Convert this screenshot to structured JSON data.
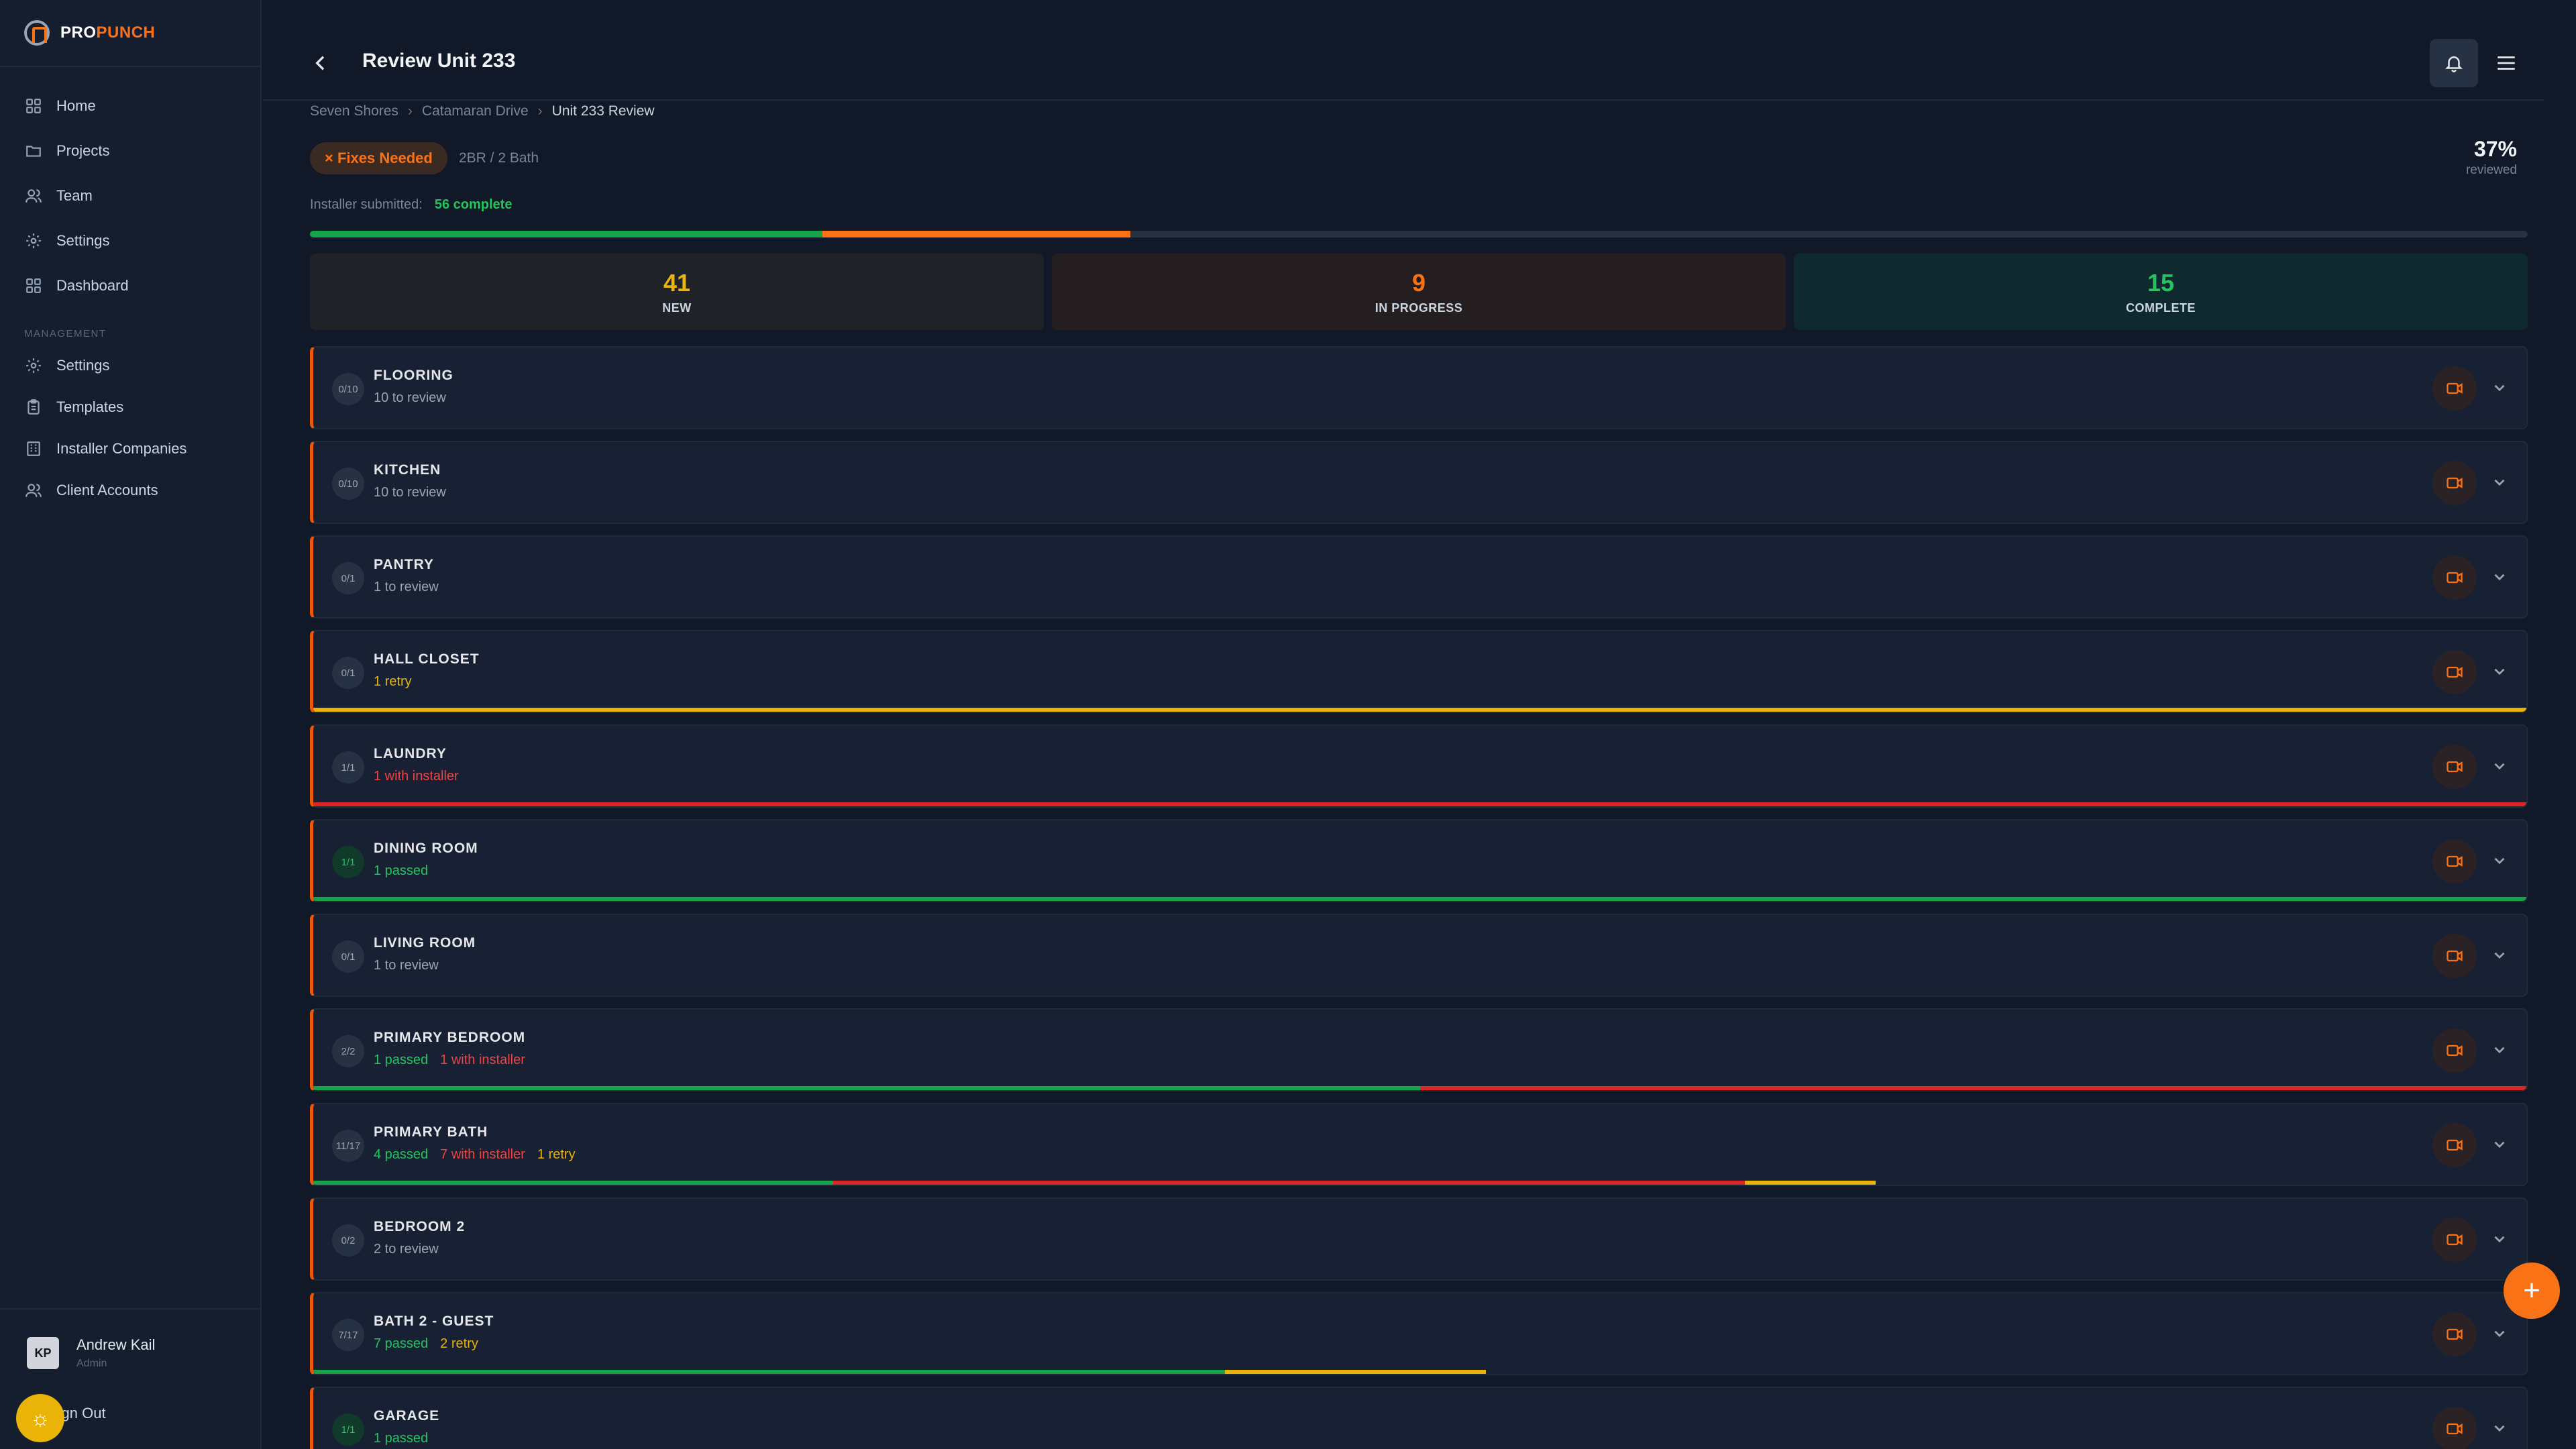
{
  "brand": {
    "pro": "PRO",
    "punch": "PUNCH"
  },
  "sidebar": {
    "main_items": [
      {
        "label": "Home",
        "icon": "grid-icon"
      },
      {
        "label": "Projects",
        "icon": "folder-icon"
      },
      {
        "label": "Team",
        "icon": "users-icon"
      },
      {
        "label": "Settings",
        "icon": "gear-icon"
      },
      {
        "label": "Dashboard",
        "icon": "grid-icon"
      }
    ],
    "section_label": "MANAGEMENT",
    "management_items": [
      {
        "label": "Settings",
        "icon": "gear-icon"
      },
      {
        "label": "Templates",
        "icon": "clipboard-icon"
      },
      {
        "label": "Installer Companies",
        "icon": "building-icon"
      },
      {
        "label": "Client Accounts",
        "icon": "users-icon"
      }
    ],
    "user": {
      "name": "Andrew Kail",
      "role": "Admin",
      "initials": "KP"
    },
    "signout_label": "Sign Out"
  },
  "header": {
    "title": "Review Unit 233"
  },
  "breadcrumb": [
    "Seven Shores",
    "Catamaran Drive",
    "Unit 233 Review"
  ],
  "unit": {
    "status": "× Fixes Needed",
    "meta": "2BR / 2 Bath",
    "percent": "37%",
    "percent_label": "reviewed",
    "submitted_label": "Installer submitted:",
    "submitted_value": "56 complete"
  },
  "progress": {
    "complete": 0.231,
    "in_progress": 0.139
  },
  "stats": [
    {
      "value": "41",
      "label": "NEW"
    },
    {
      "value": "9",
      "label": "IN PROGRESS"
    },
    {
      "value": "15",
      "label": "COMPLETE"
    }
  ],
  "rooms": [
    {
      "count": "0/10",
      "name": "FLOORING",
      "statuses": [
        {
          "text": "10 to review",
          "type": "review"
        }
      ],
      "bar": []
    },
    {
      "count": "0/10",
      "name": "KITCHEN",
      "statuses": [
        {
          "text": "10 to review",
          "type": "review"
        }
      ],
      "bar": []
    },
    {
      "count": "0/1",
      "name": "PANTRY",
      "statuses": [
        {
          "text": "1 to review",
          "type": "review"
        }
      ],
      "bar": []
    },
    {
      "count": "0/1",
      "name": "HALL CLOSET",
      "statuses": [
        {
          "text": "1 retry",
          "type": "retry"
        }
      ],
      "bar": [
        {
          "type": "y",
          "fraction": 1
        }
      ]
    },
    {
      "count": "1/1",
      "name": "LAUNDRY",
      "statuses": [
        {
          "text": "1 with installer",
          "type": "installer"
        }
      ],
      "bar": [
        {
          "type": "r",
          "fraction": 1
        }
      ]
    },
    {
      "count": "1/1",
      "name": "DINING ROOM",
      "statuses": [
        {
          "text": "1 passed",
          "type": "passed"
        }
      ],
      "bar": [
        {
          "type": "g",
          "fraction": 1
        }
      ],
      "passed": true
    },
    {
      "count": "0/1",
      "name": "LIVING ROOM",
      "statuses": [
        {
          "text": "1 to review",
          "type": "review"
        }
      ],
      "bar": []
    },
    {
      "count": "2/2",
      "name": "PRIMARY BEDROOM",
      "statuses": [
        {
          "text": "1 passed",
          "type": "passed"
        },
        {
          "text": "1 with installer",
          "type": "installer"
        }
      ],
      "bar": [
        {
          "type": "g",
          "fraction": 0.5
        },
        {
          "type": "r",
          "fraction": 0.5
        }
      ]
    },
    {
      "count": "11/17",
      "name": "PRIMARY BATH",
      "statuses": [
        {
          "text": "4 passed",
          "type": "passed"
        },
        {
          "text": "7 with installer",
          "type": "installer"
        },
        {
          "text": "1 retry",
          "type": "retry"
        }
      ],
      "bar": [
        {
          "type": "g",
          "fraction": 0.235
        },
        {
          "type": "r",
          "fraction": 0.412
        },
        {
          "type": "y",
          "fraction": 0.059
        }
      ]
    },
    {
      "count": "0/2",
      "name": "BEDROOM 2",
      "statuses": [
        {
          "text": "2 to review",
          "type": "review"
        }
      ],
      "bar": []
    },
    {
      "count": "7/17",
      "name": "BATH 2 - GUEST",
      "statuses": [
        {
          "text": "7 passed",
          "type": "passed"
        },
        {
          "text": "2 retry",
          "type": "retry"
        }
      ],
      "bar": [
        {
          "type": "g",
          "fraction": 0.412
        },
        {
          "type": "y",
          "fraction": 0.118
        }
      ]
    },
    {
      "count": "1/1",
      "name": "GARAGE",
      "statuses": [
        {
          "text": "1 passed",
          "type": "passed"
        }
      ],
      "bar": [
        {
          "type": "g",
          "fraction": 1
        }
      ],
      "passed": true
    }
  ],
  "colors": {
    "accent": "#f97316",
    "passed": "#22c55e",
    "installer": "#ef4444",
    "retry": "#eab308",
    "background": "#111827"
  }
}
